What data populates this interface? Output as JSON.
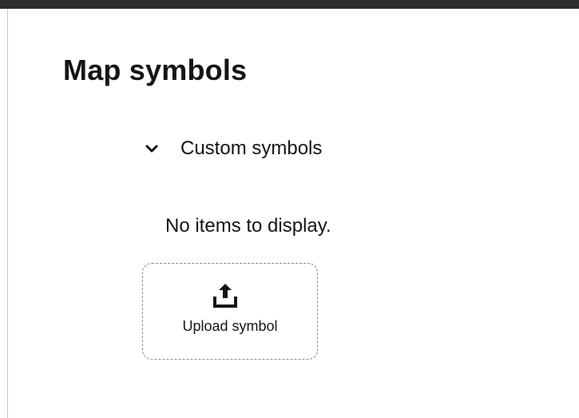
{
  "page": {
    "title": "Map symbols"
  },
  "section": {
    "label": "Custom symbols",
    "expanded": true,
    "icon": "chevron-down-icon"
  },
  "empty_state": {
    "text": "No items to display."
  },
  "upload": {
    "label": "Upload symbol",
    "icon": "upload-icon"
  },
  "colors": {
    "text": "#161513",
    "top_bar": "#2e2e2e",
    "dashed_border": "#8a8a8a"
  }
}
